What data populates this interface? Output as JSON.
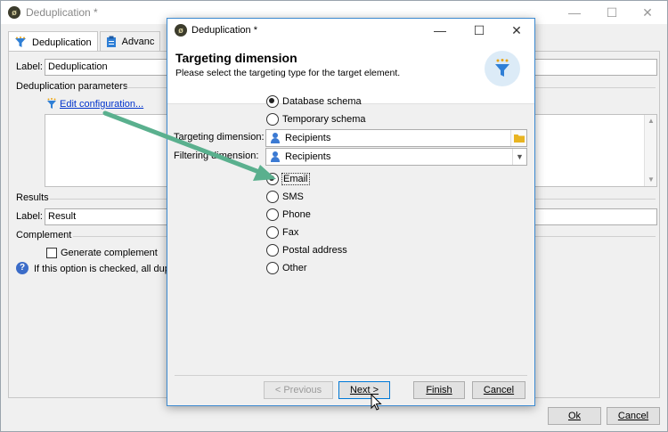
{
  "main": {
    "title": "Deduplication *",
    "tabs": [
      {
        "label": "Deduplication"
      },
      {
        "label": "Advanc"
      }
    ],
    "label_caption": "Label:",
    "label_value": "Deduplication",
    "dedup_params_heading": "Deduplication parameters",
    "edit_config_link": "Edit configuration...",
    "results_heading": "Results",
    "results_label_caption": "Label:",
    "results_label_value": "Result",
    "complement_heading": "Complement",
    "generate_complement_label": "Generate complement",
    "info_text": "If this option is checked, all dupli",
    "ok_label": "Ok",
    "cancel_label": "Cancel"
  },
  "dialog": {
    "title": "Deduplication *",
    "heading": "Targeting dimension",
    "subheading": "Please select the targeting type for the target element.",
    "schema_options": [
      {
        "label": "Database schema",
        "selected": true
      },
      {
        "label": "Temporary schema",
        "selected": false
      }
    ],
    "targeting_dimension_label": "Targeting dimension:",
    "targeting_dimension_value": "Recipients",
    "filtering_dimension_label": "Filtering dimension:",
    "filtering_dimension_value": "Recipients",
    "channel_options": [
      {
        "label": "Email",
        "selected": true
      },
      {
        "label": "SMS",
        "selected": false
      },
      {
        "label": "Phone",
        "selected": false
      },
      {
        "label": "Fax",
        "selected": false
      },
      {
        "label": "Postal address",
        "selected": false
      },
      {
        "label": "Other",
        "selected": false
      }
    ],
    "buttons": {
      "previous": "< Previous",
      "next": "Next >",
      "finish": "Finish",
      "cancel": "Cancel"
    }
  },
  "colors": {
    "accent": "#0078d7",
    "link": "#0033cc",
    "arrow": "#5ab08e",
    "person_icon": "#3b7ad3",
    "folder_icon": "#e8b422"
  }
}
